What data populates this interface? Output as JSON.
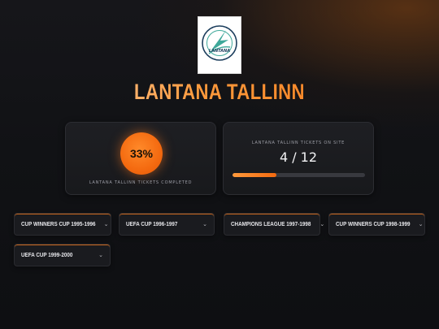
{
  "logo": {
    "alt": "Lantana Tallinn club crest",
    "ring_text_top": "FOOTBALL CLUB",
    "ring_text_bottom": "TALLINN · ESTONIA",
    "center_text": "LANTANA",
    "colors": {
      "accent": "#3fa89a",
      "dark": "#1b3d5c"
    }
  },
  "title": "LANTANA TALLINN",
  "completed_card": {
    "percent_text": "33%",
    "percent_value": 33,
    "label": "LANTANA TALLINN TICKETS COMPLETED"
  },
  "onsite_card": {
    "label": "LANTANA TALLINN TICKETS ON SITE",
    "count_text": "4 / 12",
    "progress_fraction": 0.33
  },
  "competitions": [
    {
      "label": "CUP WINNERS CUP 1995-1996",
      "icon": "chevron-down-icon"
    },
    {
      "label": "UEFA CUP 1996-1997",
      "icon": "chevron-down-icon"
    },
    {
      "label": "CHAMPIONS LEAGUE 1997-1998",
      "icon": "chevron-down-icon"
    },
    {
      "label": "CUP WINNERS CUP 1998-1999",
      "icon": "chevron-down-icon"
    },
    {
      "label": "UEFA CUP 1999-2000",
      "icon": "chevron-down-icon"
    }
  ],
  "theme": {
    "accent": "#f46a10",
    "accent_light": "#ff9a3c",
    "background": "#111215"
  }
}
